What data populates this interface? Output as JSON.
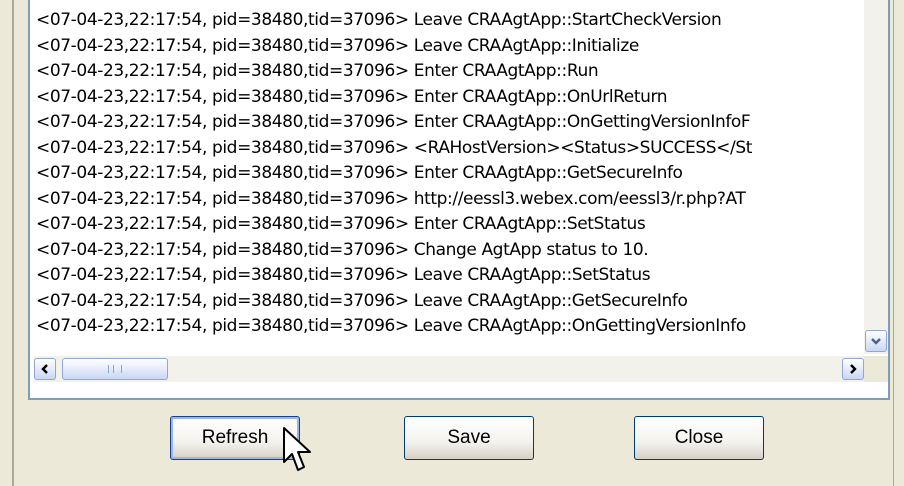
{
  "log": {
    "lines": [
      "<07-04-23,22:17:54, pid=38480,tid=37096> Leave CRAAgtApp::StartCheckVersion",
      "<07-04-23,22:17:54, pid=38480,tid=37096> Leave CRAAgtApp::Initialize",
      "<07-04-23,22:17:54, pid=38480,tid=37096> Enter CRAAgtApp::Run",
      "<07-04-23,22:17:54, pid=38480,tid=37096> Enter CRAAgtApp::OnUrlReturn",
      "<07-04-23,22:17:54, pid=38480,tid=37096> Enter CRAAgtApp::OnGettingVersionInfoF",
      "<07-04-23,22:17:54, pid=38480,tid=37096> <RAHostVersion><Status>SUCCESS</St",
      "<07-04-23,22:17:54, pid=38480,tid=37096> Enter CRAAgtApp::GetSecureInfo",
      "<07-04-23,22:17:54, pid=38480,tid=37096> http://eessl3.webex.com/eessl3/r.php?AT",
      "<07-04-23,22:17:54, pid=38480,tid=37096> Enter CRAAgtApp::SetStatus",
      "<07-04-23,22:17:54, pid=38480,tid=37096> Change AgtApp status to 10.",
      "<07-04-23,22:17:54, pid=38480,tid=37096> Leave CRAAgtApp::SetStatus",
      "<07-04-23,22:17:54, pid=38480,tid=37096> Leave CRAAgtApp::GetSecureInfo",
      "<07-04-23,22:17:54, pid=38480,tid=37096> Leave CRAAgtApp::OnGettingVersionInfo"
    ]
  },
  "buttons": {
    "refresh": "Refresh",
    "save": "Save",
    "close": "Close"
  },
  "icons": {
    "scroll_down": "chevron-down-icon",
    "scroll_left": "chevron-left-icon",
    "scroll_right": "chevron-right-icon",
    "cursor": "mouse-pointer-icon"
  },
  "colors": {
    "dialog_bg": "#ece9d8",
    "box_border": "#7f9db9",
    "scroll_accent": "#4d6185"
  }
}
